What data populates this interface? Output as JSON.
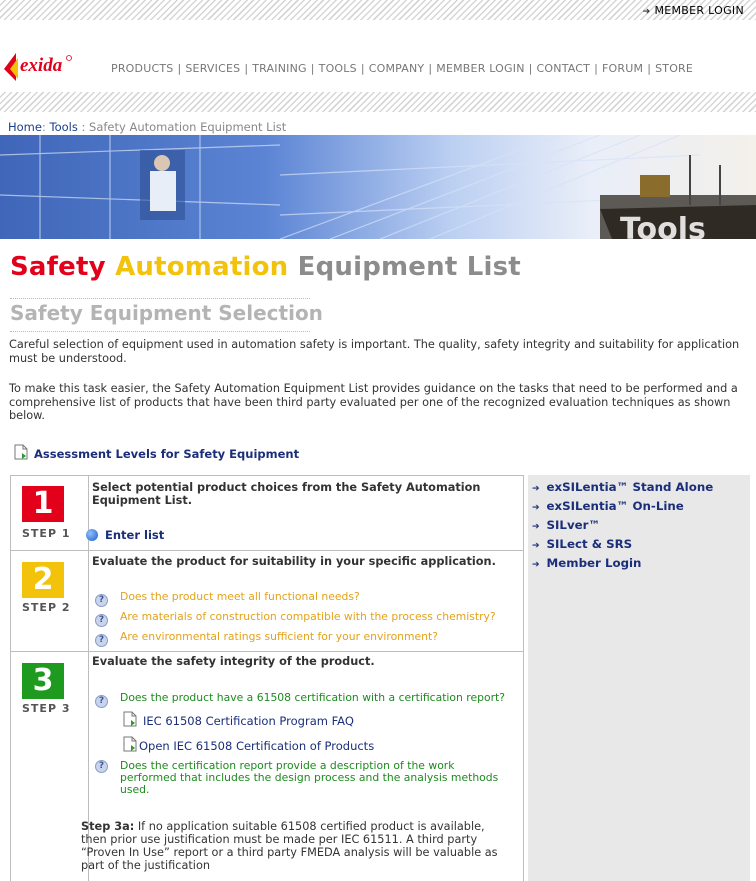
{
  "header": {
    "member_login": "MEMBER LOGIN",
    "logo_alt": "exida"
  },
  "nav": {
    "items": [
      "PRODUCTS",
      "SERVICES",
      "TRAINING",
      "TOOLS",
      "COMPANY",
      "MEMBER LOGIN",
      "CONTACT",
      "FORUM",
      "STORE"
    ]
  },
  "breadcrumb": {
    "home": "Home",
    "sep1": ":",
    "tools": "Tools",
    "sep2": ":",
    "current": "Safety Automation Equipment List"
  },
  "banner": {
    "overlay_text": "Tools"
  },
  "page": {
    "title_word1": "Safety",
    "title_word2": "Automation",
    "title_word3": "Equipment List",
    "subtitle": "Safety Equipment Selection",
    "para1": "Careful selection of equipment used in automation safety is important. The quality, safety integrity and suitability for application must be understood.",
    "para2": "To make this task easier, the Safety Automation Equipment List provides guidance on the tasks that need to be performed and a comprehensive list of products that have been third party evaluated per one of the recognized evaluation techniques as shown below.",
    "assessment_link": "Assessment Levels for Safety Equipment"
  },
  "steps": [
    {
      "number": "1",
      "label": "STEP 1",
      "color": "#e3001b",
      "heading": "Select potential product choices from the Safety Automation Equipment List.",
      "action": "Enter list"
    },
    {
      "number": "2",
      "label": "STEP 2",
      "color": "#f3c20a",
      "heading": "Evaluate the product for suitability in your specific application.",
      "questions": [
        "Does the product meet all functional needs?",
        "Are materials of construction compatible with the process chemistry?",
        "Are environmental ratings sufficient for your environment?"
      ]
    },
    {
      "number": "3",
      "label": "STEP 3",
      "color": "#1e9a1e",
      "heading": "Evaluate the safety integrity of the product.",
      "question1": "Does the product have a 61508 certification with a certification report?",
      "link1": "IEC 61508 Certification Program FAQ",
      "link2": "Open IEC 61508 Certification of Products",
      "question2": "Does the certification report provide a description of the work performed that includes the design process and the analysis methods used.",
      "step3a_label": "Step 3a:",
      "step3a_text": " If no application suitable 61508 certified product is available, then prior use justification must be made per IEC 61511. A third party “Proven In Use” report or a third party FMEDA analysis will be valuable as part of the justification"
    }
  ],
  "sidebar": {
    "links": [
      "exSILentia™ Stand Alone",
      "exSILentia™ On-Line",
      "SILver™",
      "SILect & SRS",
      "Member Login"
    ]
  }
}
